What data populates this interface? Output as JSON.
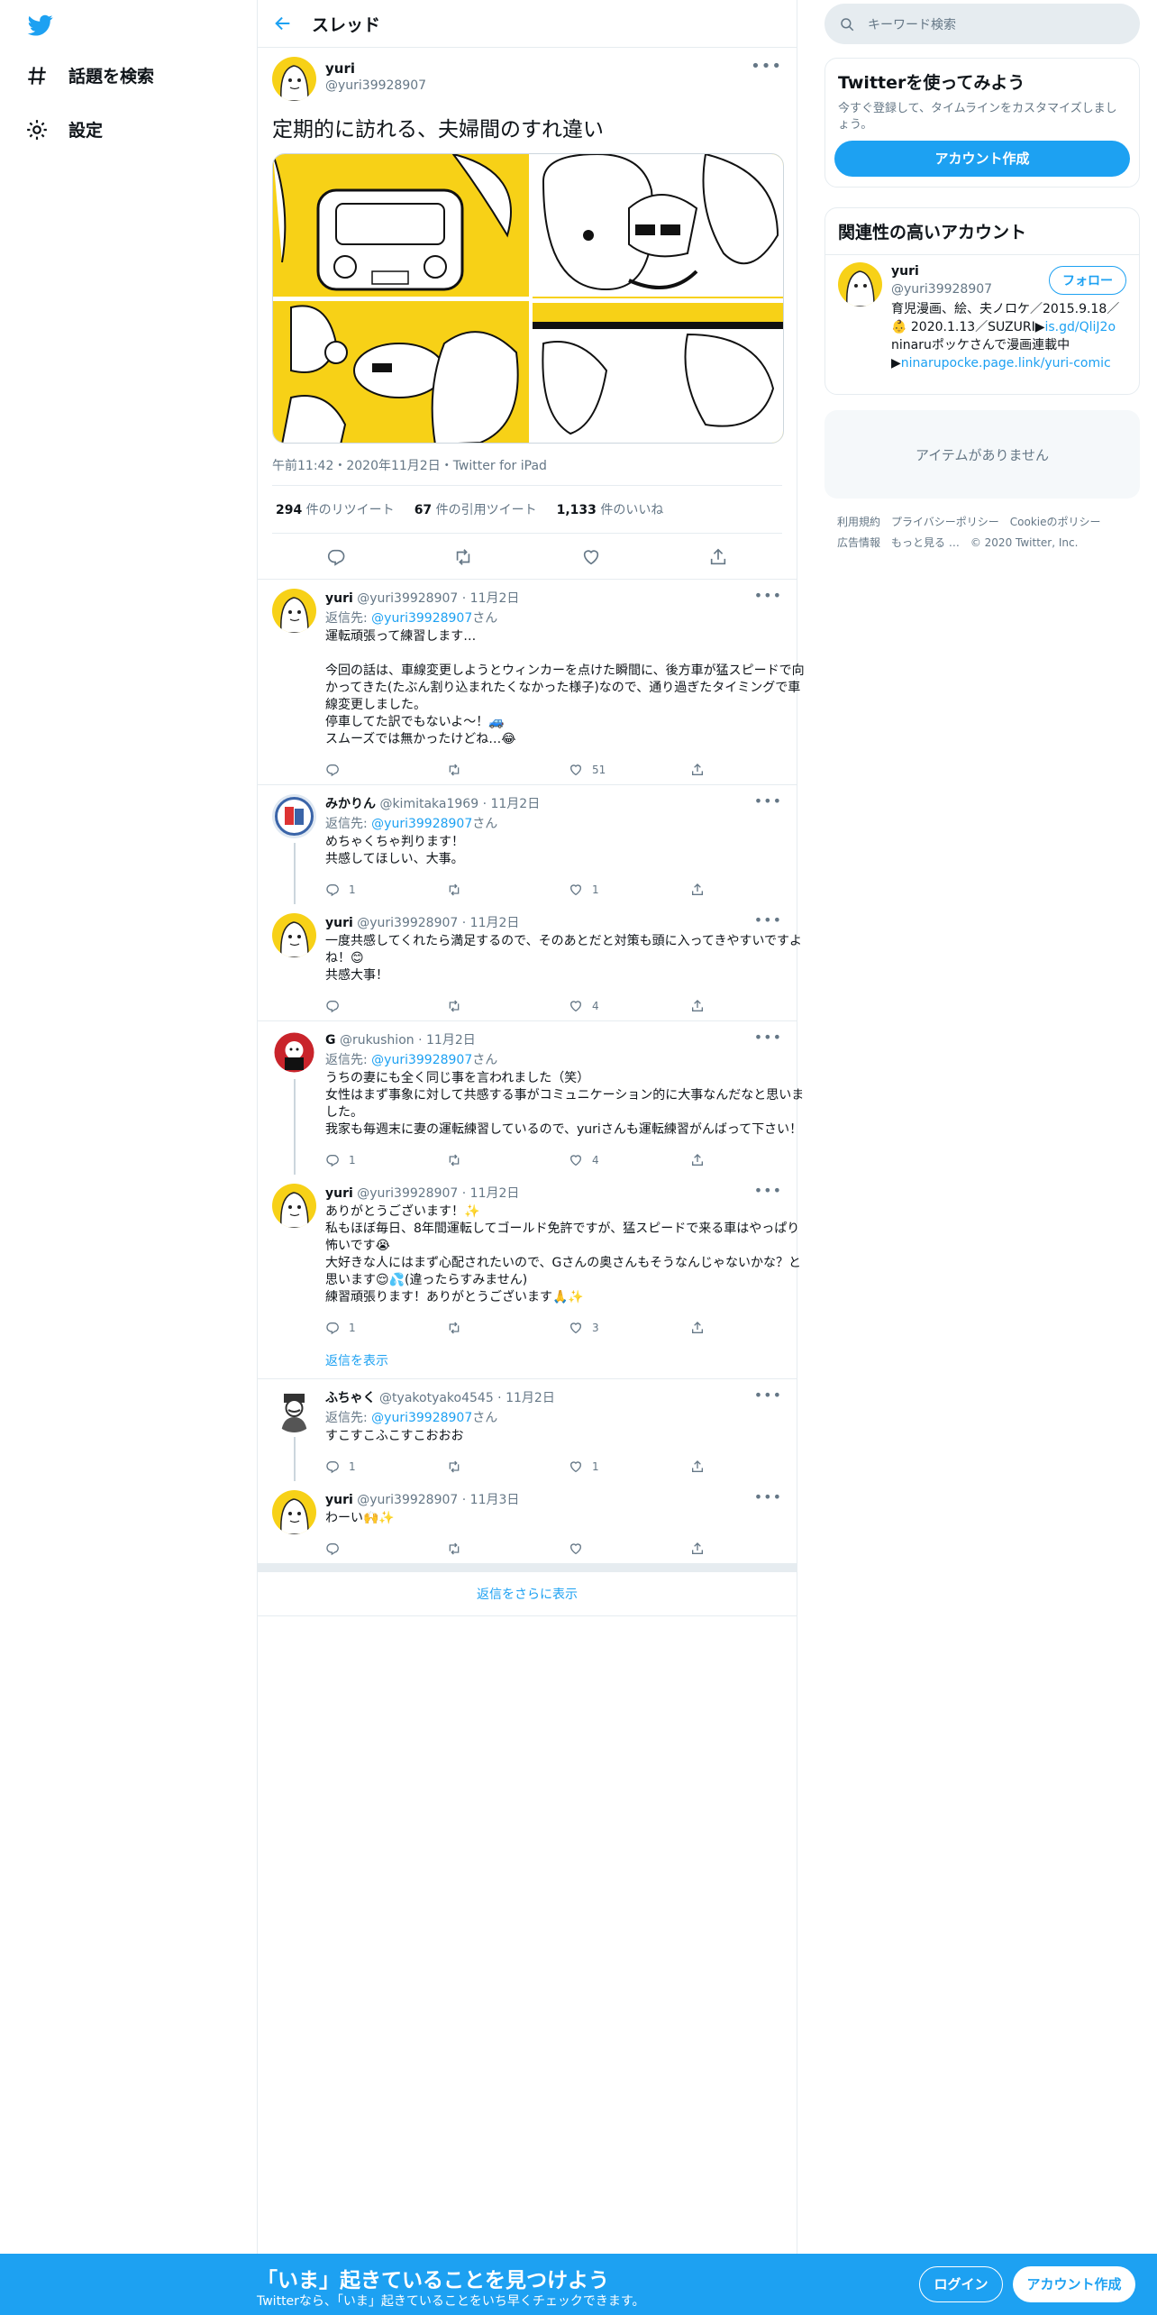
{
  "nav": {
    "explore_label": "話題を検索",
    "settings_label": "設定"
  },
  "header": {
    "title": "スレッド"
  },
  "main_tweet": {
    "name": "yuri",
    "handle": "@yuri39928907",
    "text": "定期的に訪れる、夫婦間のすれ違い",
    "meta": "午前11:42・2020年11月2日・Twitter for iPad",
    "retweets_num": "294",
    "retweets_label": " 件のリツイート",
    "quotes_num": "67",
    "quotes_label": " 件の引用ツイート",
    "likes_num": "1,133",
    "likes_label": " 件のいいね"
  },
  "reply_prefix": "返信先: ",
  "reply_suffix": "さん",
  "replies": [
    {
      "name": "yuri",
      "handle": "@yuri39928907",
      "date": "11月2日",
      "to": "@yuri39928907",
      "text": "運転頑張って練習します…\n\n今回の話は、車線変更しようとウィンカーを点けた瞬間に、後方車が猛スピードで向かってきた(たぶん割り込まれたくなかった様子)なので、通り過ぎたタイミングで車線変更しました。\n停車してた訳でもないよ〜！🚙\nスムーズでは無かったけどね…😂",
      "replies": "",
      "retweets": "",
      "likes": "51"
    },
    {
      "name": "みかりん",
      "handle": "@kimitaka1969",
      "date": "11月2日",
      "to": "@yuri39928907",
      "text": "めちゃくちゃ判ります！\n共感してほしい、大事。",
      "replies": "1",
      "retweets": "",
      "likes": "1"
    },
    {
      "name": "yuri",
      "handle": "@yuri39928907",
      "date": "11月2日",
      "to": "",
      "text": "一度共感してくれたら満足するので、そのあとだと対策も頭に入ってきやすいですよね！😊\n共感大事！",
      "replies": "",
      "retweets": "",
      "likes": "4"
    },
    {
      "name": "G",
      "handle": "@rukushion",
      "date": "11月2日",
      "to": "@yuri39928907",
      "text": "うちの妻にも全く同じ事を言われました（笑）\n女性はまず事象に対して共感する事がコミュニケーション的に大事なんだなと思いました。\n我家も毎週末に妻の運転練習しているので、yuriさんも運転練習がんばって下さい！",
      "replies": "1",
      "retweets": "",
      "likes": "4"
    },
    {
      "name": "yuri",
      "handle": "@yuri39928907",
      "date": "11月2日",
      "to": "",
      "text": "ありがとうございます！✨\n私もほぼ毎日、8年間運転してゴールド免許ですが、猛スピードで来る車はやっぱり怖いです😭\n大好きな人にはまず心配されたいので、Gさんの奥さんもそうなんじゃないかな？と思います😌💦(違ったらすみません)\n練習頑張ります！ありがとうございます🙏✨",
      "replies": "1",
      "retweets": "",
      "likes": "3"
    },
    {
      "name": "ふちゃく",
      "handle": "@tyakotyako4545",
      "date": "11月2日",
      "to": "@yuri39928907",
      "text": "すこすこふこすこおおお",
      "replies": "1",
      "retweets": "",
      "likes": "1"
    },
    {
      "name": "yuri",
      "handle": "@yuri39928907",
      "date": "11月3日",
      "to": "",
      "text": "わーい🙌✨",
      "replies": "",
      "retweets": "",
      "likes": ""
    }
  ],
  "show_replies_label": "返信を表示",
  "more_replies_label": "返信をさらに表示",
  "right": {
    "search_placeholder": "キーワード検索",
    "try_title": "Twitterを使ってみよう",
    "try_sub": "今すぐ登録して、タイムラインをカスタマイズしましょう。",
    "create_account": "アカウント作成",
    "related_title": "関連性の高いアカウント",
    "rec_name": "yuri",
    "rec_handle": "@yuri39928907",
    "follow_label": "フォロー",
    "rec_bio_1": "育児漫画、絵、夫ノロケ／2015.9.18／👶 2020.1.13／SUZURI▶",
    "rec_bio_link1": "is.gd/QliJ2o",
    "rec_bio_2": " ninaruポッケさんで漫画連載中▶",
    "rec_bio_link2": "ninarupocke.page.link/yuri-comic",
    "no_items": "アイテムがありません",
    "footer": [
      "利用規約",
      "プライバシーポリシー",
      "Cookieのポリシー",
      "広告情報",
      "もっと見る …",
      "© 2020 Twitter, Inc."
    ]
  },
  "bottom": {
    "title": "「いま」起きていることを見つけよう",
    "sub": "Twitterなら、「いま」起きていることをいち早くチェックできます。",
    "login": "ログイン",
    "signup": "アカウント作成"
  },
  "colors": {
    "accent": "#1da1f2",
    "border": "#e6ecf0",
    "muted": "#657786",
    "manga_yellow": "#f7d117"
  }
}
